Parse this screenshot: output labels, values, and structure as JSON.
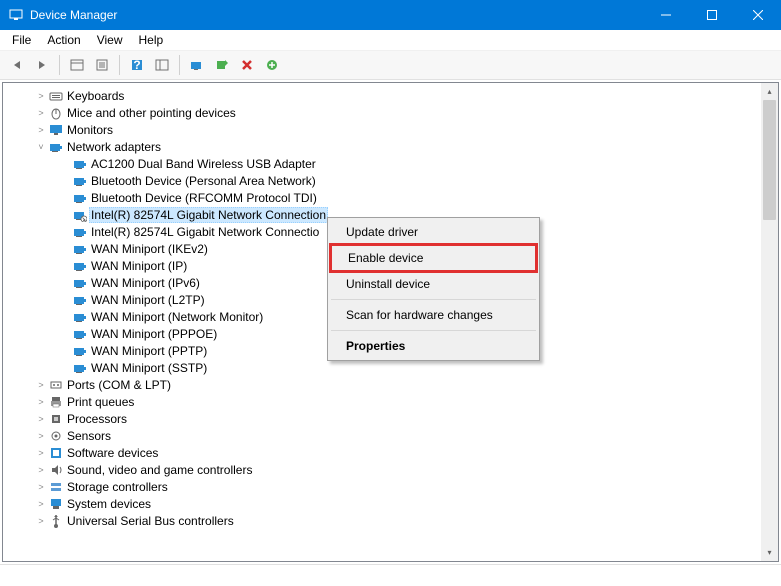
{
  "window": {
    "title": "Device Manager"
  },
  "menu": {
    "file": "File",
    "action": "Action",
    "view": "View",
    "help": "Help"
  },
  "tree": {
    "categories": [
      {
        "label": "Keyboards",
        "icon": "keyboard",
        "expanded": false
      },
      {
        "label": "Mice and other pointing devices",
        "icon": "mouse",
        "expanded": false
      },
      {
        "label": "Monitors",
        "icon": "monitor",
        "expanded": false
      },
      {
        "label": "Network adapters",
        "icon": "network",
        "expanded": true,
        "children": [
          {
            "label": "AC1200  Dual Band Wireless USB Adapter",
            "icon": "network"
          },
          {
            "label": "Bluetooth Device (Personal Area Network)",
            "icon": "network"
          },
          {
            "label": "Bluetooth Device (RFCOMM Protocol TDI)",
            "icon": "network"
          },
          {
            "label": "Intel(R) 82574L Gigabit Network Connection",
            "icon": "network-disabled",
            "selected": true
          },
          {
            "label": "Intel(R) 82574L Gigabit Network Connectio",
            "icon": "network"
          },
          {
            "label": "WAN Miniport (IKEv2)",
            "icon": "network"
          },
          {
            "label": "WAN Miniport (IP)",
            "icon": "network"
          },
          {
            "label": "WAN Miniport (IPv6)",
            "icon": "network"
          },
          {
            "label": "WAN Miniport (L2TP)",
            "icon": "network"
          },
          {
            "label": "WAN Miniport (Network Monitor)",
            "icon": "network"
          },
          {
            "label": "WAN Miniport (PPPOE)",
            "icon": "network"
          },
          {
            "label": "WAN Miniport (PPTP)",
            "icon": "network"
          },
          {
            "label": "WAN Miniport (SSTP)",
            "icon": "network"
          }
        ]
      },
      {
        "label": "Ports (COM & LPT)",
        "icon": "ports",
        "expanded": false
      },
      {
        "label": "Print queues",
        "icon": "printer",
        "expanded": false
      },
      {
        "label": "Processors",
        "icon": "processor",
        "expanded": false
      },
      {
        "label": "Sensors",
        "icon": "sensor",
        "expanded": false
      },
      {
        "label": "Software devices",
        "icon": "software",
        "expanded": false
      },
      {
        "label": "Sound, video and game controllers",
        "icon": "sound",
        "expanded": false
      },
      {
        "label": "Storage controllers",
        "icon": "storage",
        "expanded": false
      },
      {
        "label": "System devices",
        "icon": "system",
        "expanded": false
      },
      {
        "label": "Universal Serial Bus controllers",
        "icon": "usb",
        "expanded": false
      }
    ]
  },
  "context_menu": {
    "update": "Update driver",
    "enable": "Enable device",
    "uninstall": "Uninstall device",
    "scan": "Scan for hardware changes",
    "properties": "Properties"
  }
}
